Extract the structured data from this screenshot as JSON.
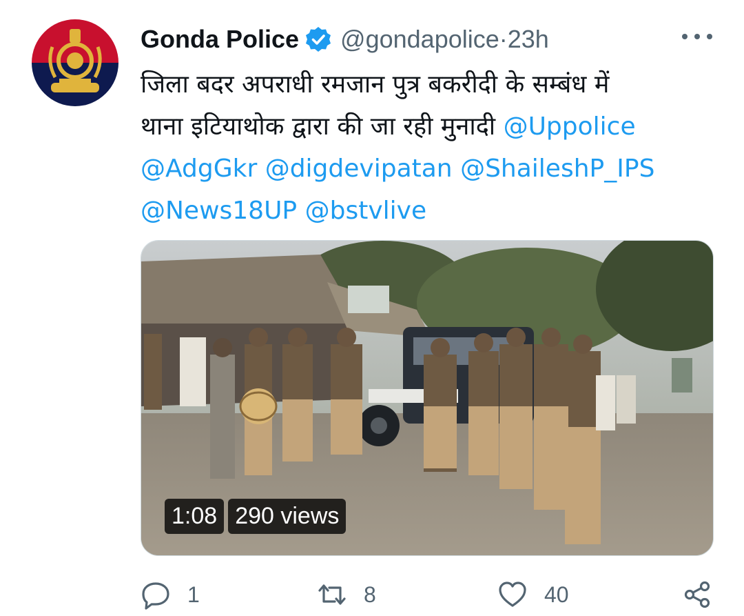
{
  "tweet": {
    "author_name": "Gonda Police",
    "handle": "@gondapolice",
    "separator": " · ",
    "time": "23h",
    "text_parts": [
      {
        "text": "जिला बदर अपराधी रमजान पुत्र बकरीदी के सम्बंध में\nथाना इटियाथोक द्वारा की जा रही मुनादी "
      },
      {
        "text": "@Uppolice",
        "mention": true
      },
      {
        "text": "\n"
      },
      {
        "text": "@AdgGkr",
        "mention": true
      },
      {
        "text": " "
      },
      {
        "text": "@digdevipatan",
        "mention": true
      },
      {
        "text": " "
      },
      {
        "text": "@ShaileshP_IPS",
        "mention": true
      },
      {
        "text": "\n"
      },
      {
        "text": "@News18UP",
        "mention": true
      },
      {
        "text": " "
      },
      {
        "text": "@bstvlive",
        "mention": true
      }
    ],
    "video": {
      "duration": "1:08",
      "views": "290 views"
    },
    "actions": {
      "replies": "1",
      "retweets": "8",
      "likes": "40"
    }
  },
  "icons": {
    "verified": "verified-badge-icon",
    "more": "more-options-icon",
    "reply": "reply-icon",
    "retweet": "retweet-icon",
    "like": "heart-icon",
    "share": "share-icon"
  },
  "colors": {
    "mention": "#1d9bf0",
    "secondary_text": "#536471",
    "verified": "#1d9bf0",
    "avatar_red": "#c8102e",
    "avatar_blue": "#0e1a4f"
  }
}
